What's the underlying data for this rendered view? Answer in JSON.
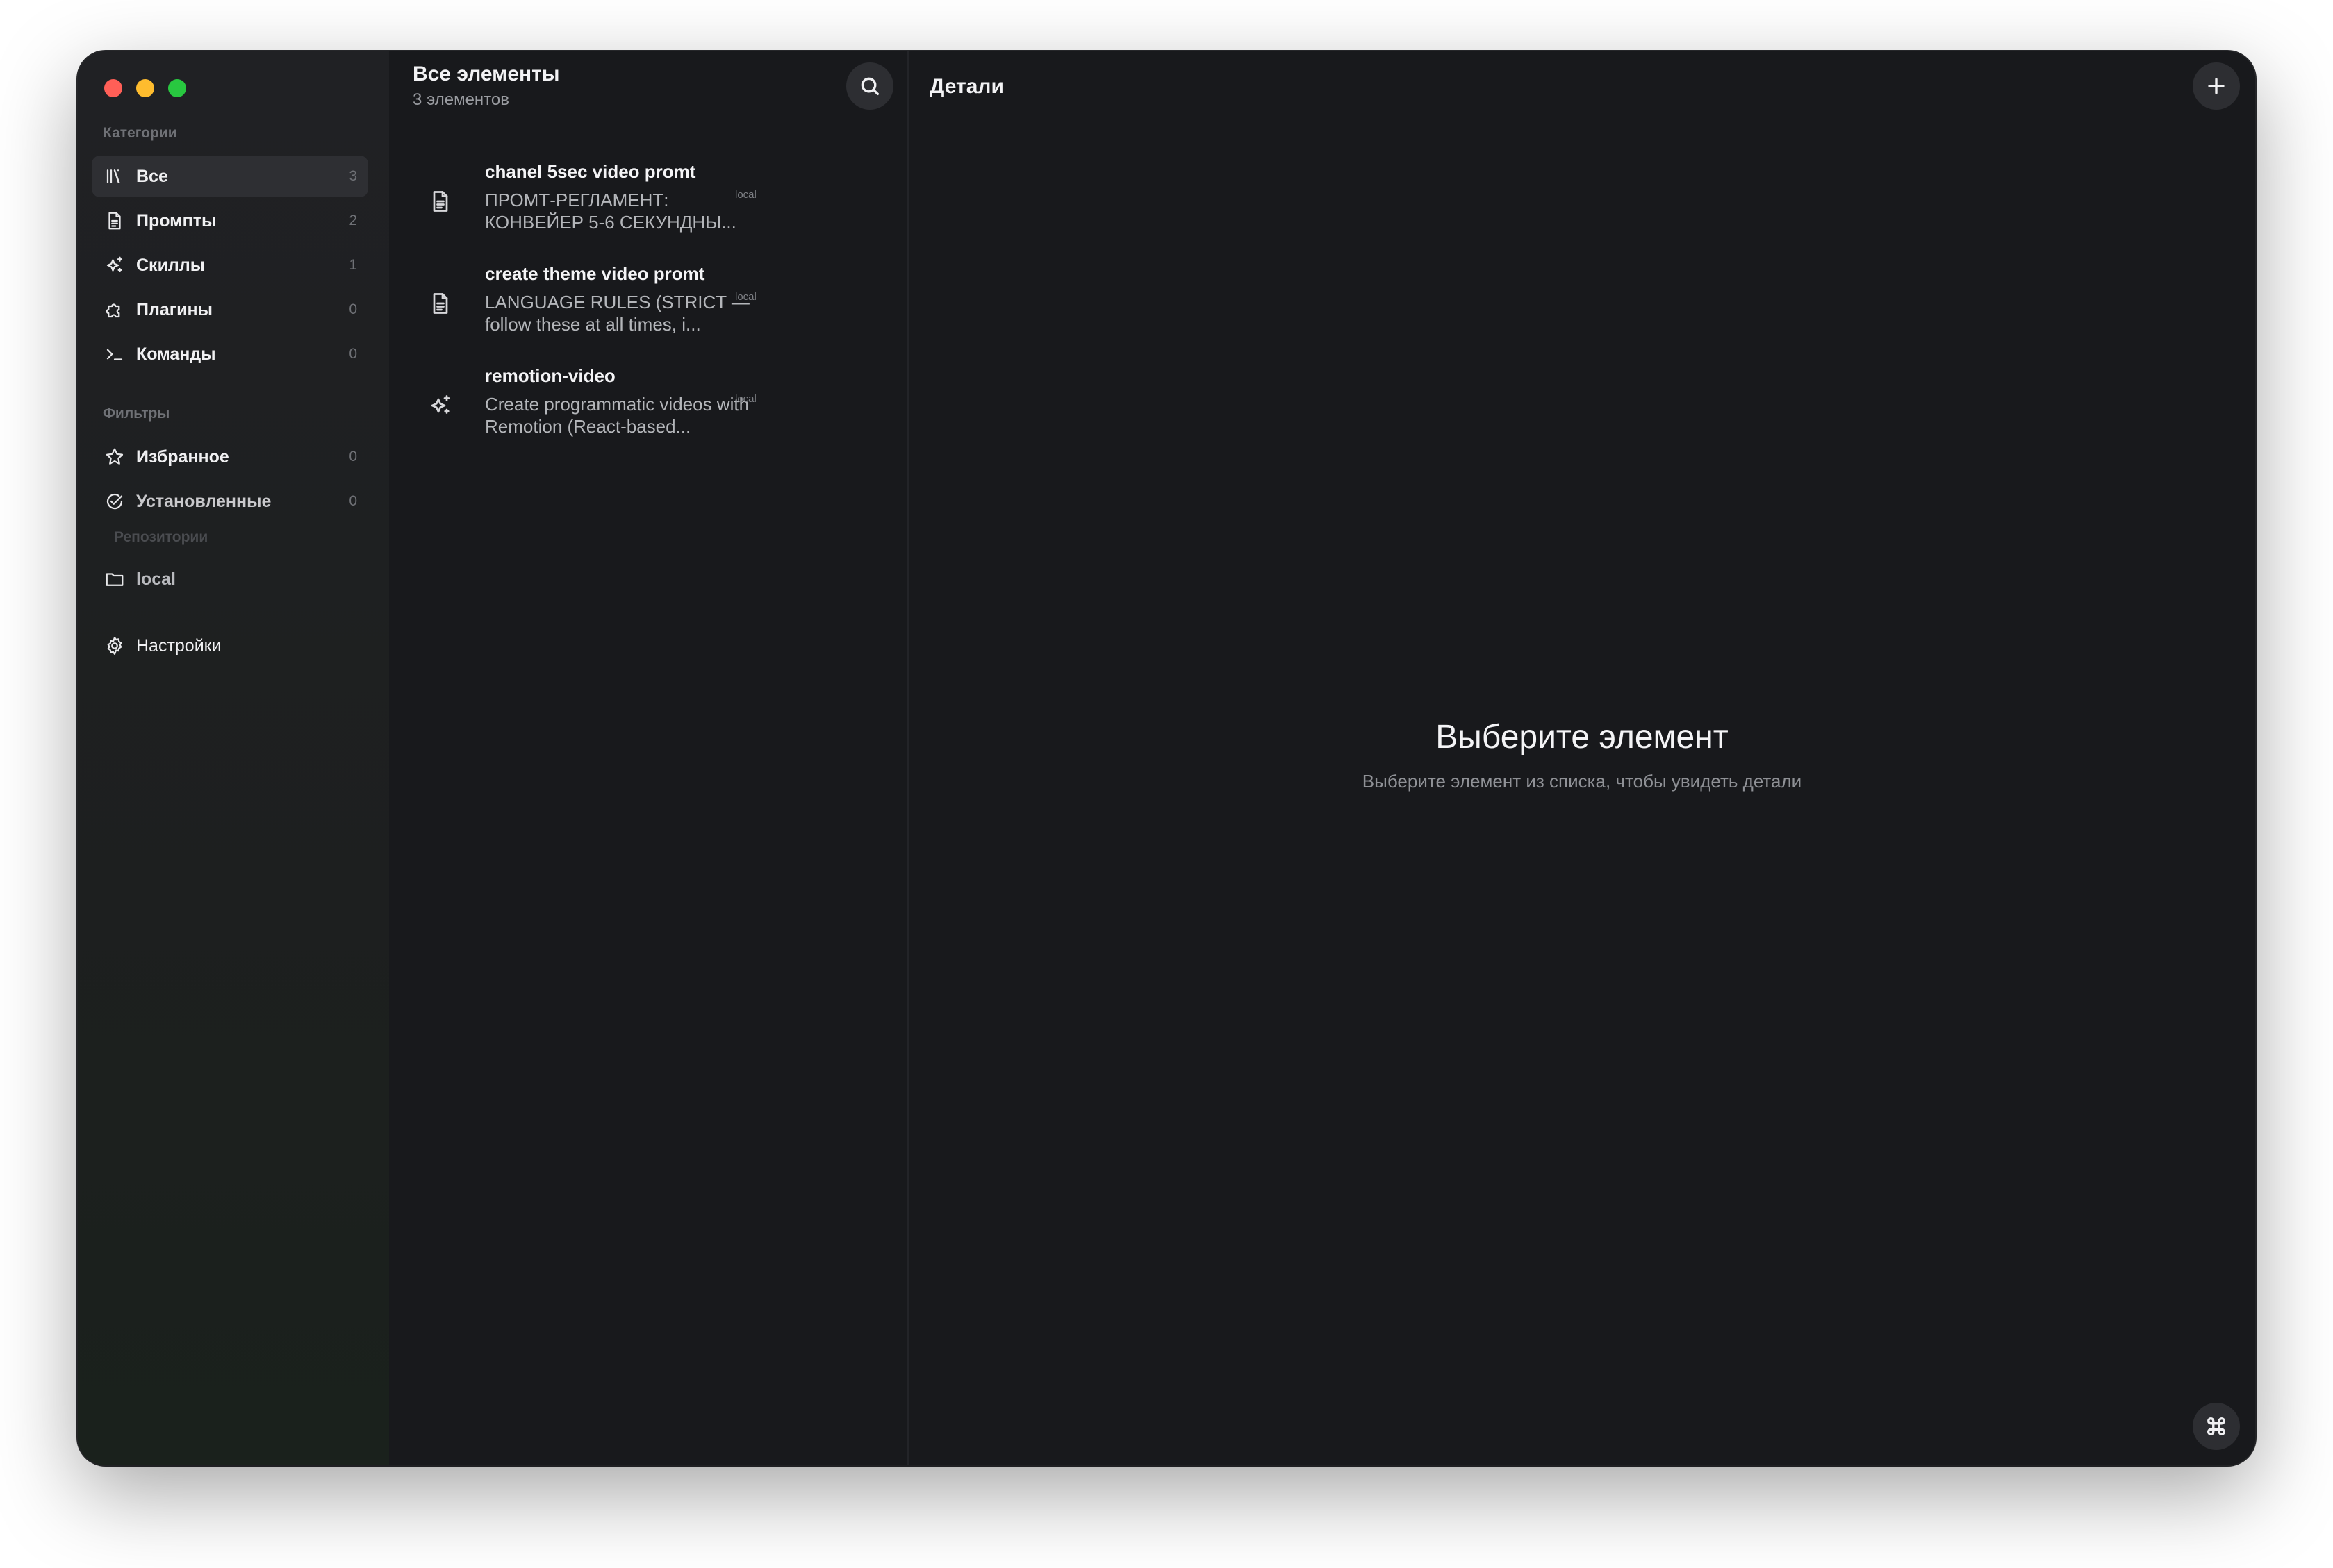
{
  "window": {
    "traffic_lights": [
      "close",
      "minimize",
      "zoom"
    ]
  },
  "sidebar": {
    "categories_label": "Категории",
    "categories": [
      {
        "label": "Все",
        "count": "3",
        "icon": "library-icon"
      },
      {
        "label": "Промпты",
        "count": "2",
        "icon": "document-icon"
      },
      {
        "label": "Скиллы",
        "count": "1",
        "icon": "sparkles-icon"
      },
      {
        "label": "Плагины",
        "count": "0",
        "icon": "puzzle-icon"
      },
      {
        "label": "Команды",
        "count": "0",
        "icon": "terminal-icon"
      }
    ],
    "filters_label": "Фильтры",
    "filters": [
      {
        "label": "Избранное",
        "count": "0",
        "icon": "star-icon"
      },
      {
        "label": "Установленные",
        "count": "0",
        "icon": "check-circle-icon"
      }
    ],
    "repositories_label": "Репозитории",
    "repositories": [
      {
        "label": "local",
        "icon": "folder-icon"
      }
    ],
    "settings_label": "Настройки"
  },
  "list": {
    "title": "Все элементы",
    "subtitle": "3 элементов",
    "items": [
      {
        "title": "chanel 5sec video promt",
        "description": "ПРОМТ-РЕГЛАМЕНТ: КОНВЕЙЕР 5-6 СЕКУНДНЫ...",
        "tag": "local",
        "icon": "document-icon"
      },
      {
        "title": "create theme video promt",
        "description": "LANGUAGE RULES (STRICT — follow these at all times, i...",
        "tag": "local",
        "icon": "document-icon"
      },
      {
        "title": "remotion-video",
        "description": "Create programmatic videos with Remotion (React-based...",
        "tag": "local",
        "icon": "sparkles-icon"
      }
    ]
  },
  "detail": {
    "title": "Детали",
    "empty_title": "Выберите элемент",
    "empty_subtitle": "Выберите элемент из списка, чтобы увидеть детали"
  }
}
